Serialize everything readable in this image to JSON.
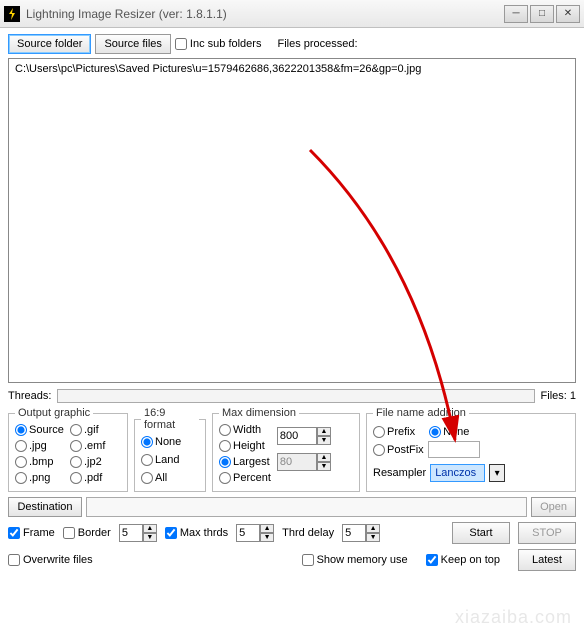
{
  "window": {
    "title": "Lightning Image Resizer (ver: 1.8.1.1)"
  },
  "toolbar": {
    "source_folder": "Source folder",
    "source_files": "Source files",
    "inc_sub_folders": "Inc sub folders",
    "files_processed_label": "Files processed:"
  },
  "filelist": {
    "items": [
      "C:\\Users\\pc\\Pictures\\Saved Pictures\\u=1579462686,3622201358&fm=26&gp=0.jpg"
    ]
  },
  "threads": {
    "label": "Threads:",
    "files_label": "Files: 1"
  },
  "output_graphic": {
    "legend": "Output graphic",
    "options": [
      "Source",
      ".gif",
      ".jpg",
      ".emf",
      ".bmp",
      ".jp2",
      ".png",
      ".pdf"
    ],
    "selected": "Source"
  },
  "format169": {
    "legend": "16:9 format",
    "options": [
      "None",
      "Land",
      "All"
    ],
    "selected": "None"
  },
  "max_dimension": {
    "legend": "Max dimension",
    "options": [
      "Width",
      "Height",
      "Largest",
      "Percent"
    ],
    "selected": "Largest",
    "value1": "800",
    "value2": "80"
  },
  "file_name_addition": {
    "legend": "File name addition",
    "prefix": "Prefix",
    "none": "None",
    "postfix": "PostFix",
    "selected": "None",
    "resampler_label": "Resampler",
    "resampler_value": "Lanczos"
  },
  "destination": {
    "button": "Destination",
    "open": "Open"
  },
  "options": {
    "frame": "Frame",
    "border": "Border",
    "border_val": "5",
    "max_thrds": "Max thrds",
    "max_thrds_val": "5",
    "thrd_delay": "Thrd delay",
    "thrd_delay_val": "5",
    "start": "Start",
    "stop": "STOP"
  },
  "bottom": {
    "overwrite": "Overwrite files",
    "show_mem": "Show memory use",
    "keep_on_top": "Keep on top",
    "latest": "Latest"
  }
}
